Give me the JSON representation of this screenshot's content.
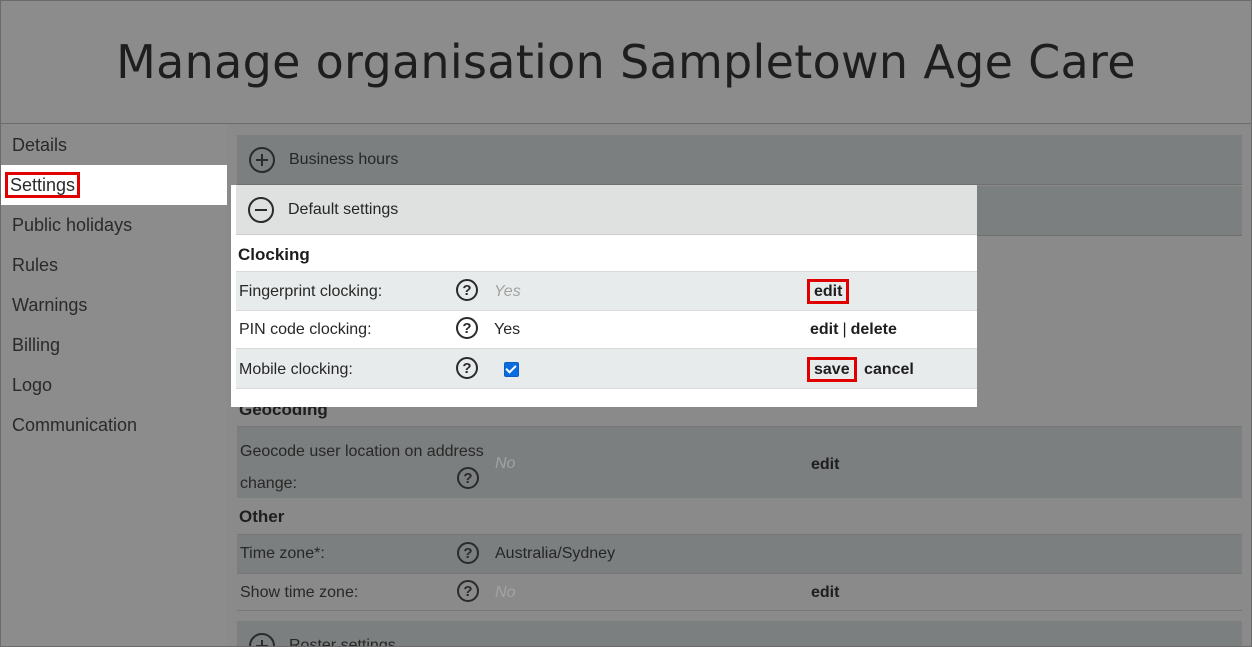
{
  "page": {
    "title": "Manage organisation Sampletown Age Care"
  },
  "sidebar": {
    "items": [
      {
        "label": "Details"
      },
      {
        "label": "Settings"
      },
      {
        "label": "Public holidays"
      },
      {
        "label": "Rules"
      },
      {
        "label": "Warnings"
      },
      {
        "label": "Billing"
      },
      {
        "label": "Logo"
      },
      {
        "label": "Communication"
      }
    ],
    "active": "Settings"
  },
  "accordions": {
    "business_hours": "Business hours",
    "default_settings": "Default settings",
    "roster_settings": "Roster settings"
  },
  "clocking": {
    "title": "Clocking",
    "fingerprint": {
      "label": "Fingerprint clocking:",
      "value": "Yes",
      "edit": "edit"
    },
    "pin": {
      "label": "PIN code clocking:",
      "value": "Yes",
      "edit": "edit",
      "sep": "|",
      "delete": "delete"
    },
    "mobile": {
      "label": "Mobile clocking:",
      "checked": true,
      "save": "save",
      "cancel": "cancel"
    }
  },
  "geocoding": {
    "title": "Geocoding",
    "geocode_user": {
      "label_line1": "Geocode user location on address",
      "label_line2": "change:",
      "value": "No",
      "edit": "edit"
    }
  },
  "other": {
    "title": "Other",
    "time_zone": {
      "label": "Time zone*:",
      "value": "Australia/Sydney"
    },
    "show_time_zone": {
      "label": "Show time zone:",
      "value": "No",
      "edit": "edit"
    }
  },
  "help_glyph": "?",
  "colors": {
    "highlight_box": "#e00000",
    "checkbox": "#0a6cde"
  },
  "icons": {
    "expand": "plus-circle-icon",
    "collapse": "minus-circle-icon",
    "help": "question-circle-icon"
  }
}
